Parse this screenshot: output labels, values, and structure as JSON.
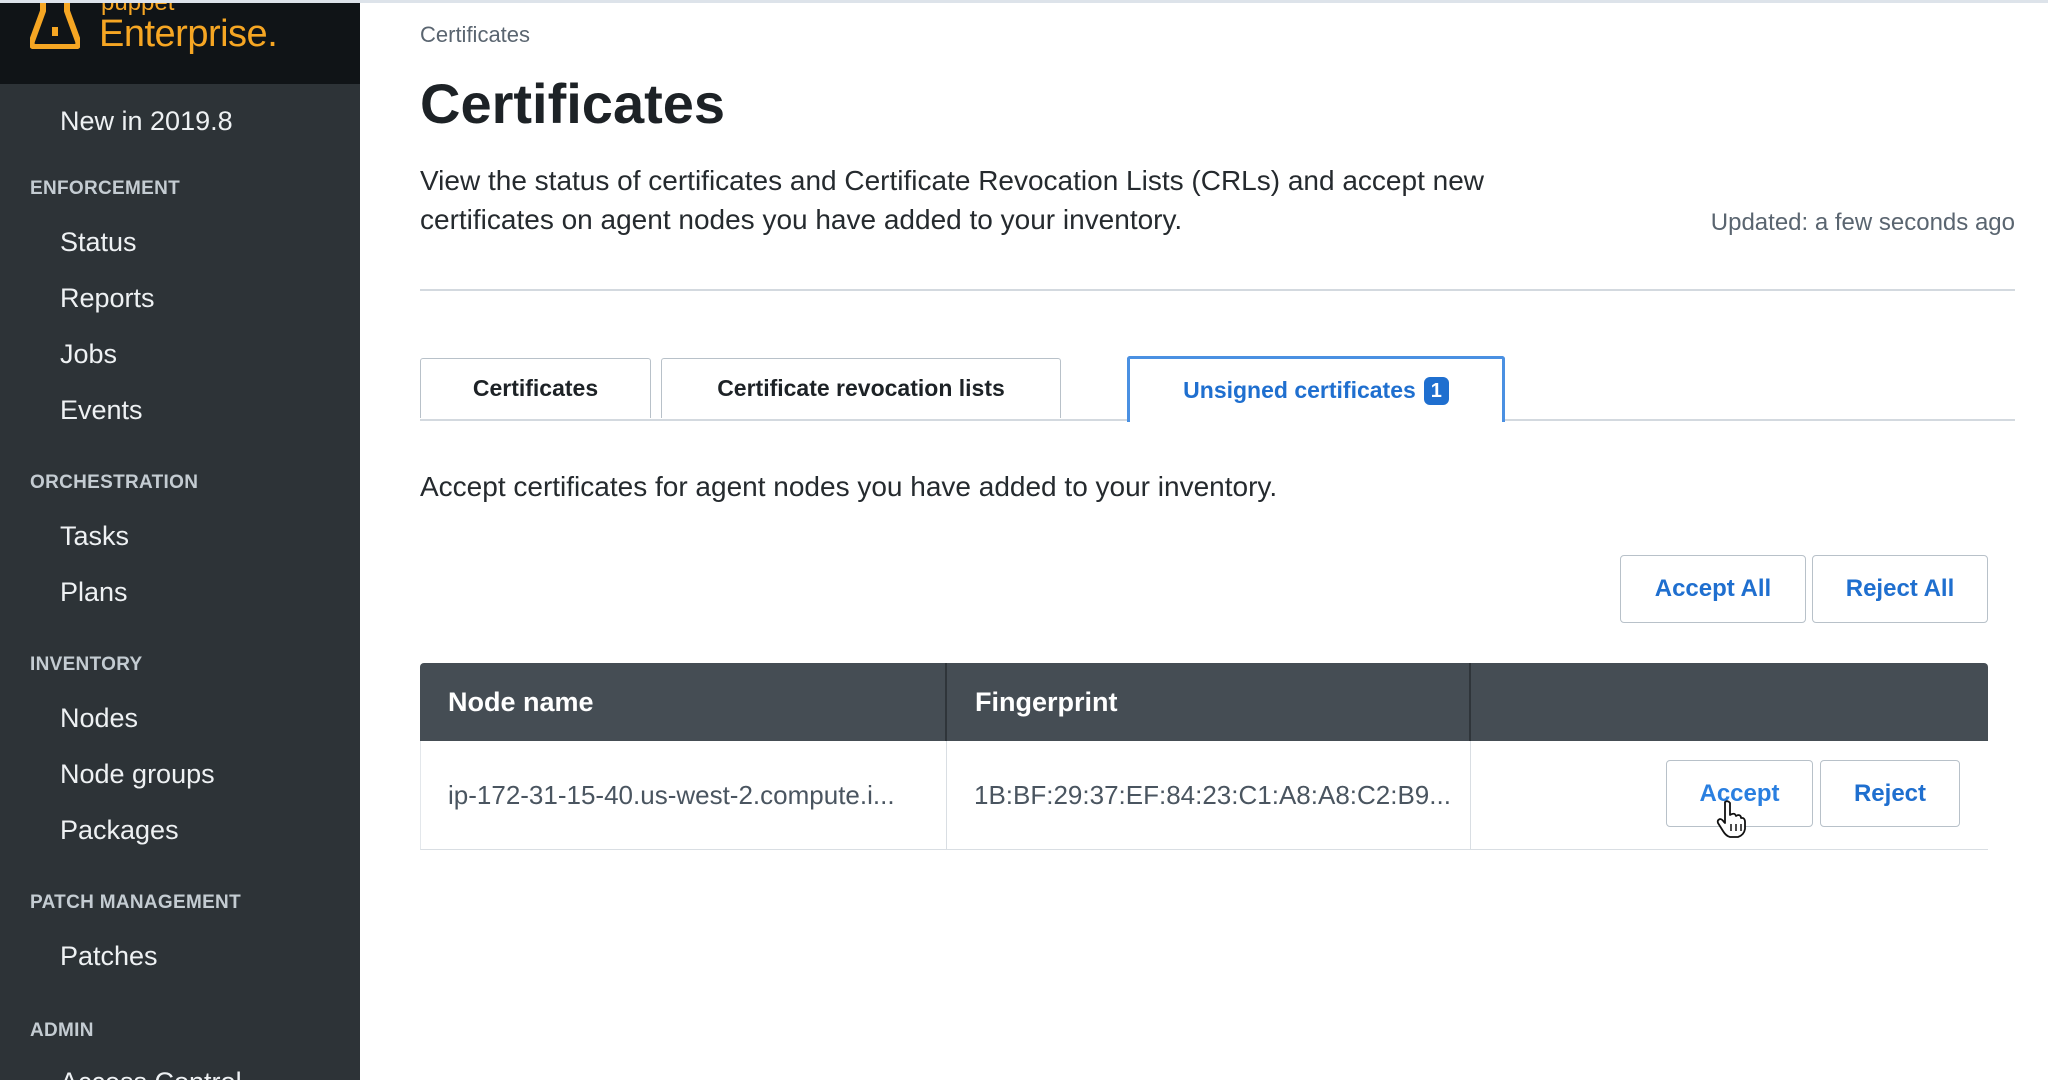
{
  "sidebar": {
    "brand_top": "puppet",
    "brand_name": "Enterprise",
    "items": [
      {
        "label": "New in 2019.8"
      },
      {
        "section": "ENFORCEMENT"
      },
      {
        "label": "Status"
      },
      {
        "label": "Reports"
      },
      {
        "label": "Jobs"
      },
      {
        "label": "Events"
      },
      {
        "section": "ORCHESTRATION"
      },
      {
        "label": "Tasks"
      },
      {
        "label": "Plans"
      },
      {
        "section": "INVENTORY"
      },
      {
        "label": "Nodes"
      },
      {
        "label": "Node groups"
      },
      {
        "label": "Packages"
      },
      {
        "section": "PATCH MANAGEMENT"
      },
      {
        "label": "Patches"
      },
      {
        "section": "ADMIN"
      },
      {
        "label": "Access Control"
      }
    ]
  },
  "main": {
    "breadcrumb": "Certificates",
    "title": "Certificates",
    "description": "View the status of certificates and Certificate Revocation Lists (CRLs) and accept new certificates on agent nodes you have added to your inventory.",
    "updated": "Updated: a few seconds ago",
    "tabs": [
      {
        "label": "Certificates"
      },
      {
        "label": "Certificate revocation lists"
      },
      {
        "label": "Unsigned certificates",
        "badge": "1"
      }
    ],
    "section_description": "Accept certificates for agent nodes you have added to your inventory.",
    "accept_all": "Accept All",
    "reject_all": "Reject All",
    "table": {
      "headers": [
        "Node name",
        "Fingerprint",
        ""
      ],
      "rows": [
        {
          "node": "ip-172-31-15-40.us-west-2.compute.i...",
          "fingerprint": "1B:BF:29:37:EF:84:23:C1:A8:A8:C2:B9...",
          "accept": "Accept",
          "reject": "Reject"
        }
      ]
    }
  },
  "colors": {
    "brand": "#f6a623",
    "sidebar": "#2d3337",
    "link": "#1f6fcf",
    "table_header": "#454d54"
  }
}
